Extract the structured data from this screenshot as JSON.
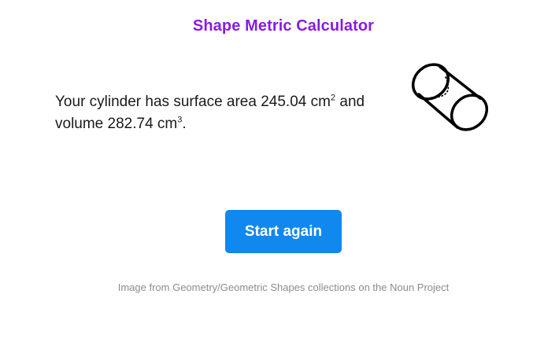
{
  "header": {
    "title": "Shape Metric Calculator"
  },
  "result": {
    "prefix": "Your cylinder has surface area ",
    "surface_area_value": "245.04 cm",
    "surface_area_exponent": "2",
    "middle": " and volume ",
    "volume_value": "282.74 cm",
    "volume_exponent": "3",
    "suffix": "."
  },
  "shape_icon": {
    "name": "cylinder-icon"
  },
  "actions": {
    "start_again_label": "Start again"
  },
  "footer": {
    "credit": "Image from Geometry/Geometric Shapes collections on the Noun Project"
  },
  "colors": {
    "title": "#8a1be0",
    "button": "#1188ee",
    "credit_text": "#8c8c8c"
  }
}
